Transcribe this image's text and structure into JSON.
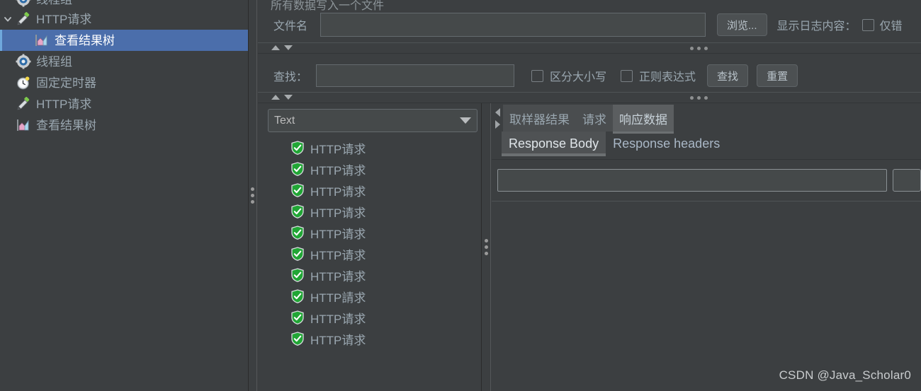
{
  "app": {
    "theme_bg": "#3c3f41",
    "selection_color": "#4b6eab",
    "text_color": "#9aa7b0"
  },
  "tree": {
    "items": [
      {
        "label": "线程组",
        "icon": "gear-icon",
        "indent": 0,
        "toggle": "none",
        "selected": false,
        "clipped": true
      },
      {
        "label": "HTTP请求",
        "icon": "sampler-icon",
        "indent": 0,
        "toggle": "expanded",
        "selected": false,
        "clipped": false
      },
      {
        "label": "查看结果树",
        "icon": "results-tree-icon",
        "indent": 2,
        "toggle": "none",
        "selected": true,
        "clipped": false
      },
      {
        "label": "线程组",
        "icon": "gear-icon",
        "indent": 0,
        "toggle": "none",
        "selected": false,
        "clipped": false
      },
      {
        "label": "固定定时器",
        "icon": "timer-icon",
        "indent": 1,
        "toggle": "none",
        "selected": false,
        "clipped": false
      },
      {
        "label": "HTTP请求",
        "icon": "sampler-icon",
        "indent": 1,
        "toggle": "none",
        "selected": false,
        "clipped": false
      },
      {
        "label": "查看结果树",
        "icon": "results-tree-icon",
        "indent": 1,
        "toggle": "none",
        "selected": false,
        "clipped": false
      }
    ]
  },
  "top_panel": {
    "clipped_title": "所有数据写入一个文件",
    "filename_label": "文件名",
    "filename_value": "",
    "browse_button": "浏览...",
    "log_content_label": "显示日志内容：",
    "errors_only_checkbox_label": "仅错",
    "errors_only_checked": false
  },
  "search_panel": {
    "find_label": "查找：",
    "find_value": "",
    "case_sensitive_label": "区分大小写",
    "case_sensitive_checked": false,
    "regex_label": "正则表达式",
    "regex_checked": false,
    "find_button": "查找",
    "reset_button": "重置"
  },
  "result_list": {
    "renderer_selected": "Text",
    "rows": [
      {
        "label": "HTTP请求",
        "status": "success"
      },
      {
        "label": "HTTP请求",
        "status": "success"
      },
      {
        "label": "HTTP请求",
        "status": "success"
      },
      {
        "label": "HTTP请求",
        "status": "success"
      },
      {
        "label": "HTTP请求",
        "status": "success"
      },
      {
        "label": "HTTP请求",
        "status": "success"
      },
      {
        "label": "HTTP请求",
        "status": "success"
      },
      {
        "label": "HTTP請求",
        "status": "success"
      },
      {
        "label": "HTTP请求",
        "status": "success"
      },
      {
        "label": "HTTP请求",
        "status": "success"
      }
    ]
  },
  "detail": {
    "tabs_level1": [
      {
        "label": "取样器结果",
        "active": false
      },
      {
        "label": "请求",
        "active": false
      },
      {
        "label": "响应数据",
        "active": true
      }
    ],
    "tabs_level2": [
      {
        "label": "Response Body",
        "active": true
      },
      {
        "label": "Response headers",
        "active": false
      }
    ],
    "response_body_value": ""
  },
  "watermark": {
    "text": "CSDN @Java_Scholar0"
  }
}
